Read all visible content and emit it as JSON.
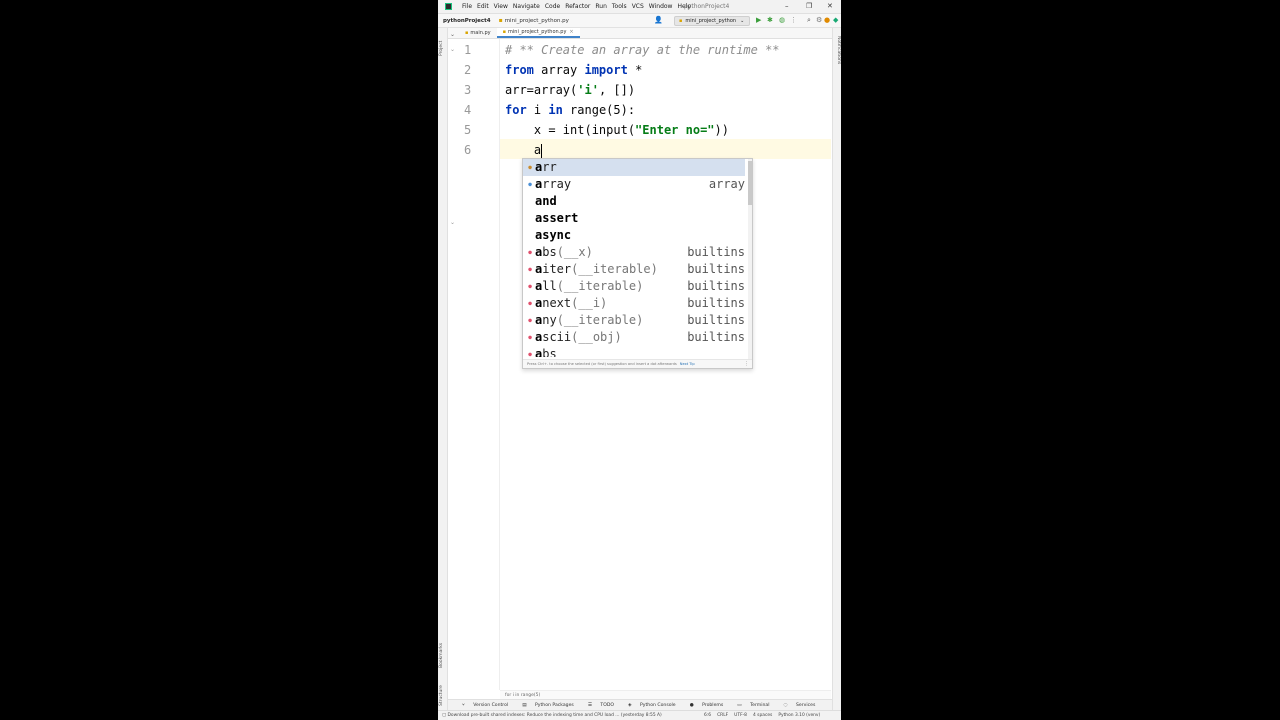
{
  "window": {
    "title": "pythonProject4",
    "menu": [
      "File",
      "Edit",
      "View",
      "Navigate",
      "Code",
      "Refactor",
      "Run",
      "Tools",
      "VCS",
      "Window",
      "Help"
    ]
  },
  "navbar": {
    "project": "pythonProject4",
    "file": "mini_project_python.py",
    "run_config": "mini_project_python"
  },
  "tabs": [
    {
      "label": "main.py"
    },
    {
      "label": "mini_project_python.py",
      "close": "×"
    }
  ],
  "tool_windows": {
    "left_top": "Project",
    "left_bottom_1": "Bookmarks",
    "left_bottom_2": "Structure",
    "right": "Notifications"
  },
  "editor": {
    "line_numbers": [
      "1",
      "2",
      "3",
      "4",
      "5",
      "6"
    ],
    "lines": {
      "l1": {
        "comment": "# ** Create an array at the runtime **"
      },
      "l2": {
        "kw1": "from",
        "t1": " array ",
        "kw2": "import",
        "t2": " *"
      },
      "l3": {
        "t1": "arr=array(",
        "s1": "'i'",
        "t2": ", [])"
      },
      "l4": {
        "kw1": "for",
        "t1": " i ",
        "kw2": "in",
        "t2": " range(5):"
      },
      "l5": {
        "t1": "    x = int(input(",
        "s1": "\"Enter no=\"",
        "t2": "))"
      },
      "l6": {
        "t1": "    a"
      }
    }
  },
  "completion": {
    "items": [
      {
        "match": "a",
        "rest": "rr",
        "tail": "",
        "type": "",
        "icon": "var"
      },
      {
        "match": "a",
        "rest": "rray",
        "tail": "",
        "type": "array",
        "icon": "module"
      },
      {
        "match": "a",
        "rest": "nd",
        "tail": "",
        "type": "",
        "icon": ""
      },
      {
        "match": "a",
        "rest": "ssert",
        "tail": "",
        "type": "",
        "icon": ""
      },
      {
        "match": "a",
        "rest": "sync",
        "tail": "",
        "type": "",
        "icon": ""
      },
      {
        "match": "a",
        "rest": "bs",
        "tail": "(__x)",
        "type": "builtins",
        "icon": "function"
      },
      {
        "match": "a",
        "rest": "iter",
        "tail": "(__iterable)",
        "type": "builtins",
        "icon": "function"
      },
      {
        "match": "a",
        "rest": "ll",
        "tail": "(__iterable)",
        "type": "builtins",
        "icon": "function"
      },
      {
        "match": "a",
        "rest": "next",
        "tail": "(__i)",
        "type": "builtins",
        "icon": "function"
      },
      {
        "match": "a",
        "rest": "ny",
        "tail": "(__iterable)",
        "type": "builtins",
        "icon": "function"
      },
      {
        "match": "a",
        "rest": "scii",
        "tail": "(__obj)",
        "type": "builtins",
        "icon": "function"
      },
      {
        "match": "a",
        "rest": "bs",
        "tail": "",
        "type": "",
        "icon": "function"
      }
    ],
    "footer": "Press Ctrl+. to choose the selected (or first) suggestion and insert a dot afterwards",
    "footer_link": "Next Tip"
  },
  "breadcrumb": "for i in range(5)",
  "bottom_tabs": [
    "Version Control",
    "Python Packages",
    "TODO",
    "Python Console",
    "Problems",
    "Terminal",
    "Services"
  ],
  "status": {
    "message": "Download pre-built shared indexes: Reduce the indexing time and CPU load ... (yesterday 8:55 A)",
    "position": "6:6",
    "line_sep": "CRLF",
    "encoding": "UTF-8",
    "indent": "4 spaces",
    "interpreter": "Python 3.10 (venv)"
  }
}
